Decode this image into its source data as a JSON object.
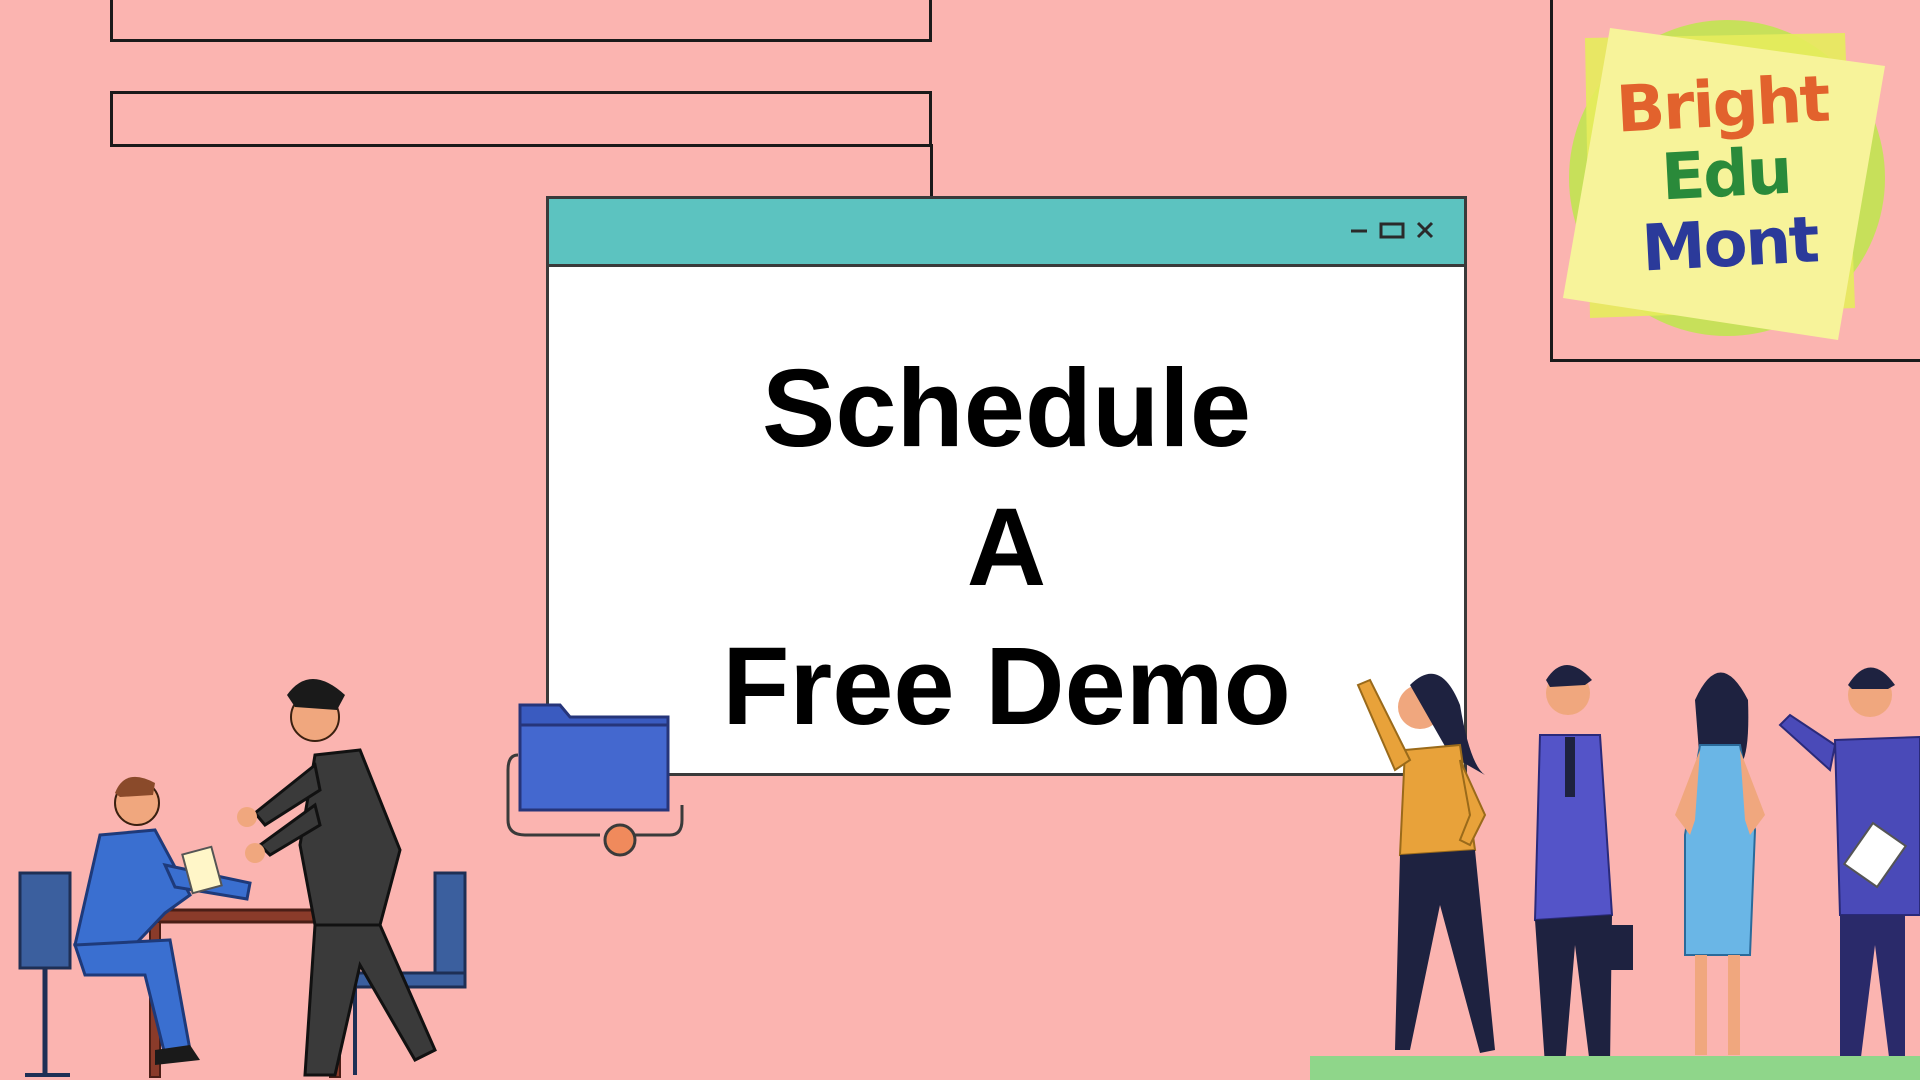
{
  "headline": {
    "line1": "Schedule",
    "line2": "A",
    "line3": "Free Demo"
  },
  "logo": {
    "word1": "Bright",
    "word2": "Edu",
    "word3": "Mont",
    "colors": {
      "word1": "#e2622d",
      "word2": "#2a8a3a",
      "word3": "#2b3a9a",
      "note": "#f7f39a",
      "circle": "#c7e05a"
    }
  },
  "window": {
    "icons": [
      "minimize-icon",
      "maximize-icon",
      "close-icon"
    ],
    "titlebar_color": "#5cc3c0"
  },
  "colors": {
    "background": "#fbb4b0",
    "folder": "#3a5bc0",
    "connector_dot": "#f08a5c"
  }
}
